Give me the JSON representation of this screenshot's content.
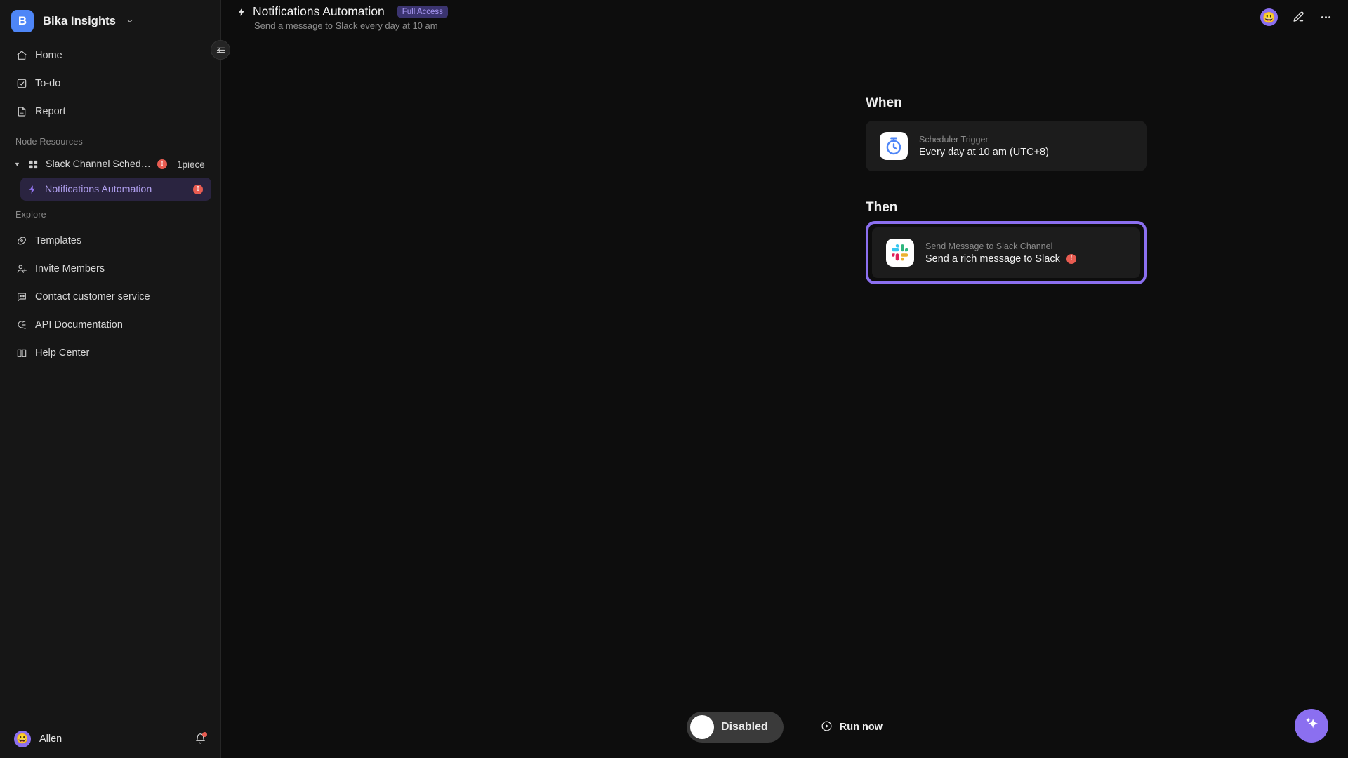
{
  "sidebar": {
    "brand": {
      "logo_letter": "B",
      "name": "Bika Insights",
      "chevron_icon": "chevron-down-icon"
    },
    "nav": [
      {
        "label": "Home",
        "icon": "home-icon"
      },
      {
        "label": "To-do",
        "icon": "checkbox-icon"
      },
      {
        "label": "Report",
        "icon": "document-icon"
      }
    ],
    "node_resources": {
      "section_label": "Node Resources",
      "tree": {
        "label": "Slack Channel Schedul...",
        "count": "1piece",
        "icon": "grid-icon",
        "caret_icon": "caret-down-icon",
        "warning_icon": "warning-badge-icon",
        "warning_mark": "!",
        "child": {
          "label": "Notifications Automation",
          "icon": "lightning-icon",
          "warning_mark": "!"
        }
      }
    },
    "explore": {
      "section_label": "Explore",
      "items": [
        {
          "label": "Templates",
          "icon": "template-icon"
        },
        {
          "label": "Invite Members",
          "icon": "user-plus-icon"
        },
        {
          "label": "Contact customer service",
          "icon": "chat-icon"
        },
        {
          "label": "API Documentation",
          "icon": "api-icon"
        },
        {
          "label": "Help Center",
          "icon": "book-icon"
        }
      ]
    },
    "user": {
      "name": "Allen",
      "avatar_emoji": "😃",
      "bell_icon": "bell-icon"
    },
    "collapse_icon": "collapse-sidebar-icon"
  },
  "header": {
    "icon": "lightning-icon",
    "title": "Notifications Automation",
    "badge": "Full Access",
    "subtitle": "Send a message to Slack every day at 10 am",
    "avatar_emoji": "😃",
    "edit_icon": "pencil-edit-icon",
    "more_icon": "more-horizontal-icon"
  },
  "flow": {
    "when_label": "When",
    "then_label": "Then",
    "trigger": {
      "type": "Scheduler Trigger",
      "detail": "Every day at 10 am (UTC+8)",
      "icon": "stopwatch-icon"
    },
    "action": {
      "type": "Send Message to Slack Channel",
      "detail": "Send a rich message to Slack",
      "icon": "slack-icon",
      "warning_mark": "!",
      "selected": true
    }
  },
  "bottombar": {
    "toggle_label": "Disabled",
    "toggle_state": "off",
    "run_label": "Run now",
    "run_icon": "play-circle-icon"
  },
  "fab": {
    "icon": "sparkle-ai-icon"
  },
  "colors": {
    "accent_purple": "#8b6ff0",
    "brand_blue": "#4e86f7",
    "warning_red": "#e85c51",
    "background": "#0d0d0d",
    "sidebar": "#161616",
    "card": "#1c1c1c"
  }
}
